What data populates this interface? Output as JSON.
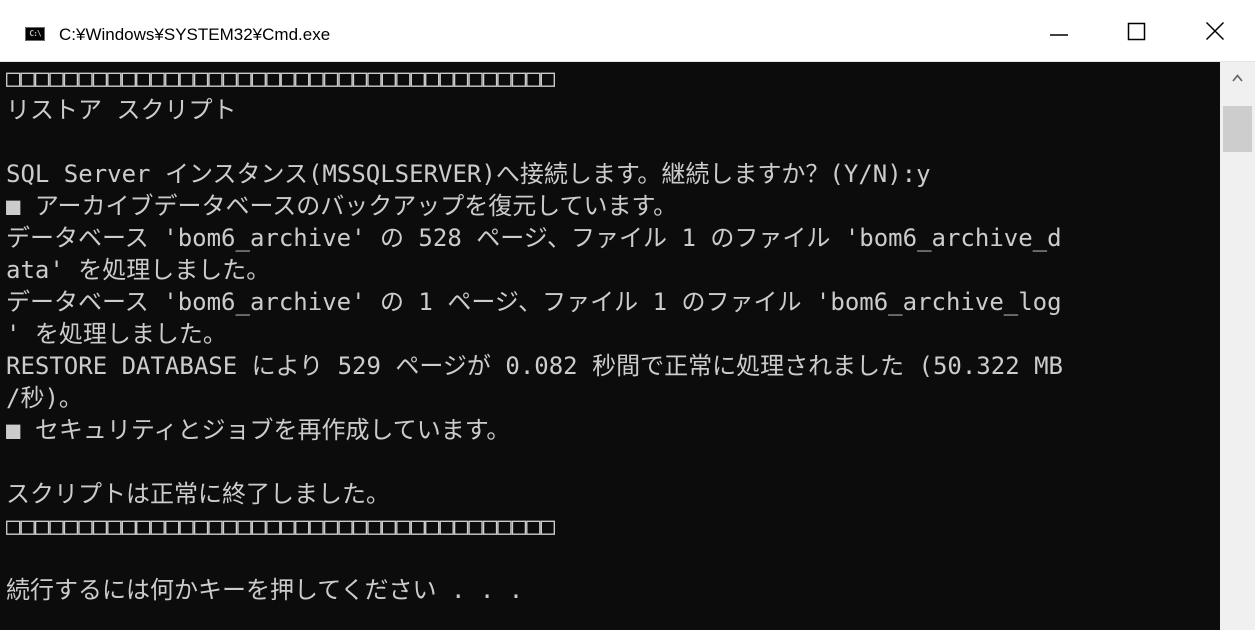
{
  "window": {
    "title": "C:¥Windows¥SYSTEM32¥Cmd.exe",
    "icon": "cmd-app-icon",
    "icon_text": "C:\\"
  },
  "controls": {
    "minimize_icon": "minimize-icon",
    "maximize_icon": "maximize-icon",
    "close_icon": "close-icon"
  },
  "console": {
    "lines": [
      "□□□□□□□□□□□□□□□□□□□□□□□□□□□□□□□□□□□□□□",
      "リストア スクリプト",
      "",
      "SQL Server インスタンス(MSSQLSERVER)へ接続します。継続しますか？(Y/N):y",
      "■ アーカイブデータベースのバックアップを復元しています。",
      "データベース 'bom6_archive' の 528 ページ、ファイル 1 のファイル 'bom6_archive_d",
      "ata' を処理しました。",
      "データベース 'bom6_archive' の 1 ページ、ファイル 1 のファイル 'bom6_archive_log",
      "' を処理しました。",
      "RESTORE DATABASE により 529 ページが 0.082 秒間で正常に処理されました (50.322 MB",
      "/秒)。",
      "■ セキュリティとジョブを再作成しています。",
      "",
      "スクリプトは正常に終了しました。",
      "□□□□□□□□□□□□□□□□□□□□□□□□□□□□□□□□□□□□□□",
      "",
      "続行するには何かキーを押してください . . ."
    ],
    "text_color": "#cccccc",
    "background": "#0c0c0c"
  },
  "scrollbar": {
    "up_icon": "scroll-up-arrow-icon"
  }
}
